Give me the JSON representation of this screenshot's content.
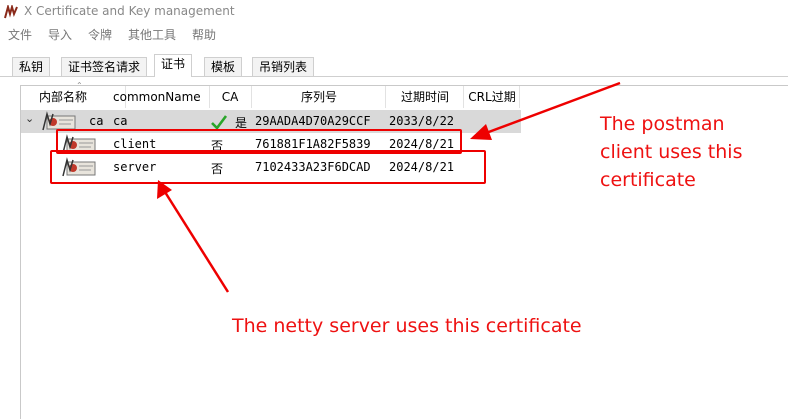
{
  "window": {
    "title": "X Certificate and Key management"
  },
  "menu": [
    "文件",
    "导入",
    "令牌",
    "其他工具",
    "帮助"
  ],
  "tabs": [
    "私钥",
    "证书签名请求",
    "证书",
    "模板",
    "吊销列表"
  ],
  "active_tab": 2,
  "table": {
    "columns": [
      "内部名称",
      "commonName",
      "CA",
      "序列号",
      "过期时间",
      "CRL过期"
    ],
    "rows": [
      {
        "internal": "ca",
        "common": "ca",
        "ca": "是",
        "serial": "29AADA4D70A29CCF",
        "expiry": "2033/8/22",
        "selected": true,
        "expander": "⌄"
      },
      {
        "internal": "",
        "common": "client",
        "ca": "否",
        "serial": "761881F1A82F5839",
        "expiry": "2024/8/21"
      },
      {
        "internal": "",
        "common": "server",
        "ca": "否",
        "serial": "7102433A23F6DCAD",
        "expiry": "2024/8/21"
      }
    ]
  },
  "annotations": {
    "client_note": [
      "The postman",
      "client uses this",
      "certificate"
    ],
    "server_note": "The netty server uses this certificate"
  },
  "colors": {
    "annotation": "#ee1111",
    "selection": "#d9d9d9",
    "checkmark": "#2aa52a"
  }
}
